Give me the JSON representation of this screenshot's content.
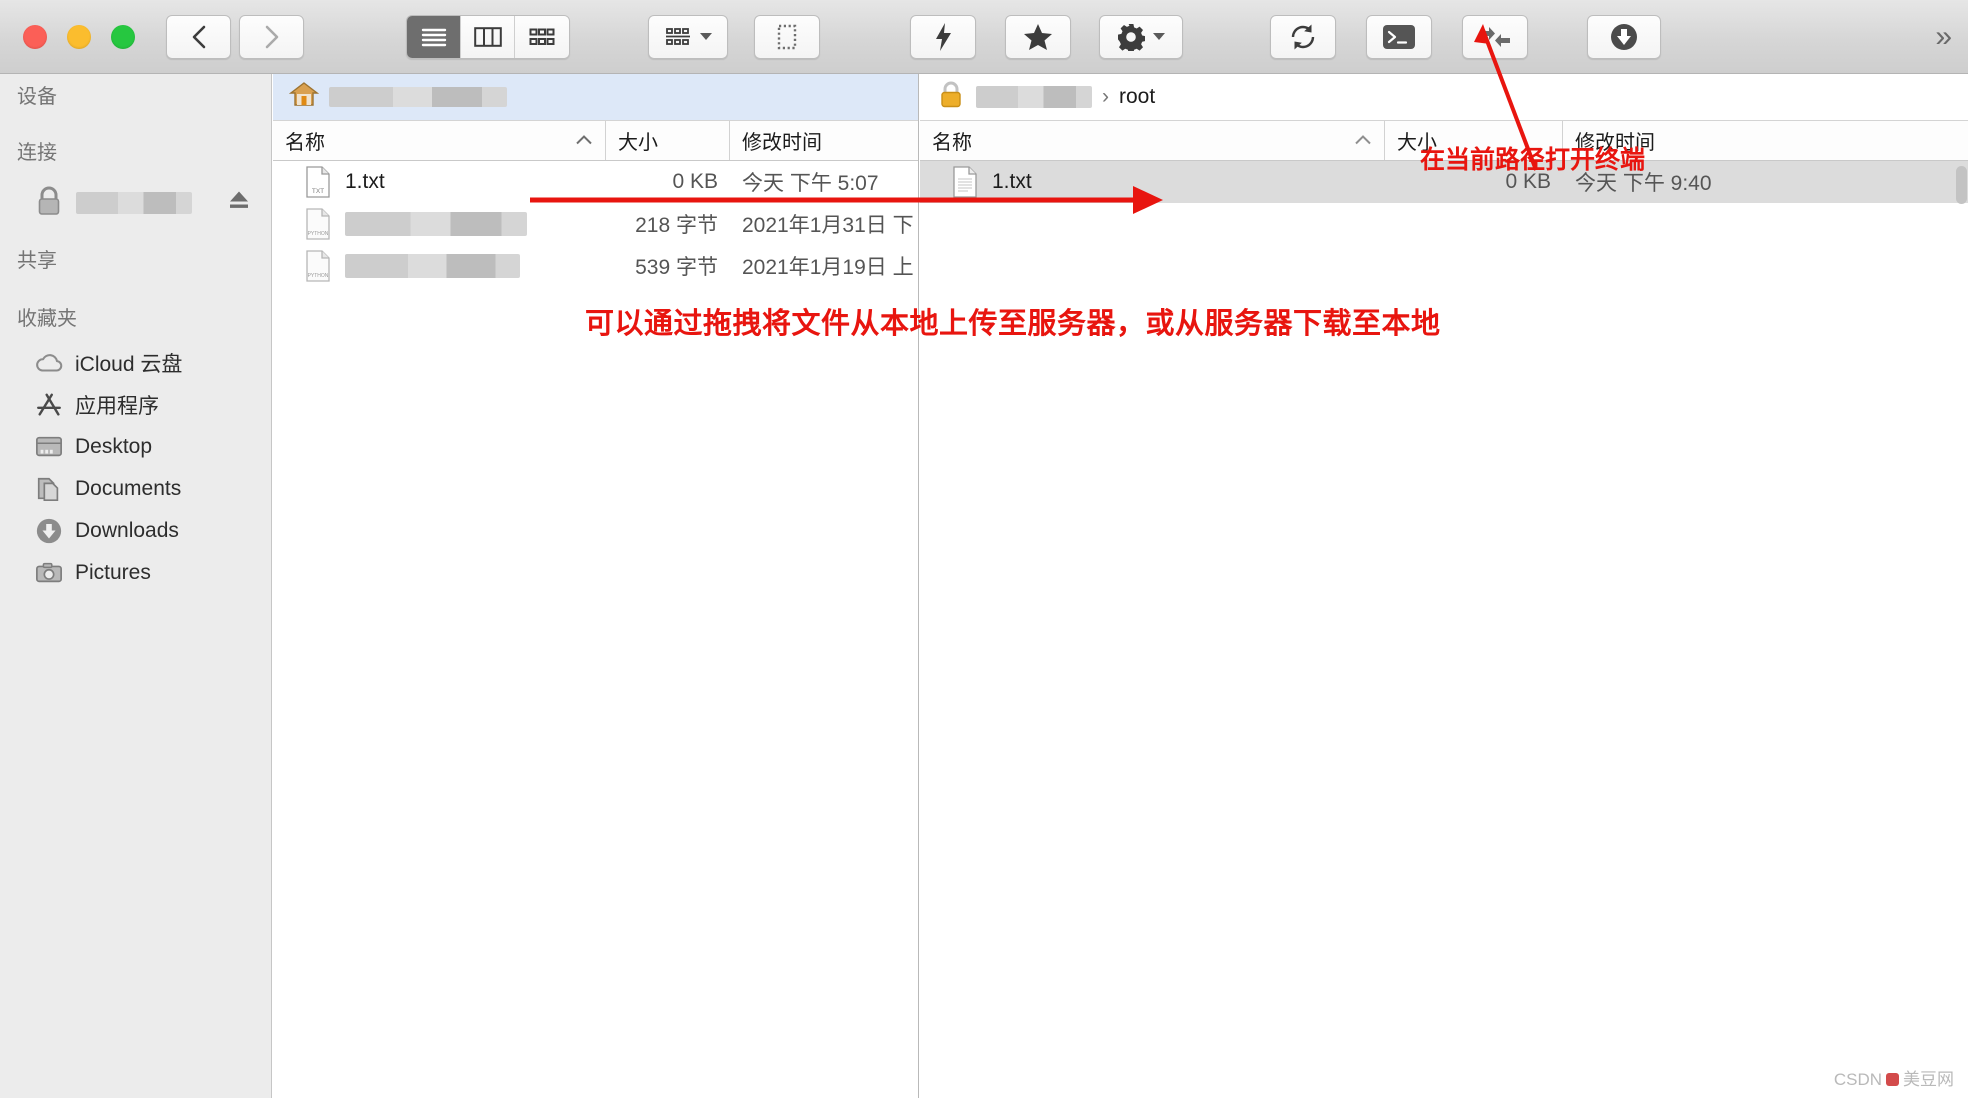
{
  "window": {
    "traffic_lights": [
      "close",
      "minimize",
      "zoom"
    ],
    "colors": {
      "close": "#fb5f57",
      "minimize": "#fbbd2e",
      "zoom": "#26c740",
      "annotation": "#e8150f",
      "selection": "#dde8f8",
      "row_selected": "#dcdcdc"
    }
  },
  "toolbar": {
    "back_label": "‹",
    "forward_label": "›",
    "view_modes": [
      {
        "name": "list-view",
        "active": true
      },
      {
        "name": "column-view",
        "active": false
      },
      {
        "name": "icon-view",
        "active": false
      }
    ],
    "buttons": [
      {
        "name": "arrange-by-button",
        "icon": "grid-icon",
        "has_chevron": true
      },
      {
        "name": "selection-button",
        "icon": "dashed-rect-icon",
        "has_chevron": false
      },
      {
        "name": "quick-action-button",
        "icon": "bolt-icon",
        "has_chevron": false
      },
      {
        "name": "favorites-button",
        "icon": "star-icon",
        "has_chevron": false
      },
      {
        "name": "settings-button",
        "icon": "gear-icon",
        "has_chevron": true
      },
      {
        "name": "refresh-button",
        "icon": "refresh-icon",
        "has_chevron": false
      },
      {
        "name": "terminal-button",
        "icon": "terminal-icon",
        "has_chevron": false
      },
      {
        "name": "sync-button",
        "icon": "sync-arrows-icon",
        "has_chevron": false
      },
      {
        "name": "download-button",
        "icon": "download-circle-icon",
        "has_chevron": false
      }
    ],
    "overflow_label": "»"
  },
  "sidebar": {
    "sections": [
      {
        "title": "设备",
        "items": []
      },
      {
        "title": "连接",
        "items": [
          {
            "label": "",
            "redacted": true,
            "icon": "lock-icon",
            "eject": true
          }
        ]
      },
      {
        "title": "共享",
        "items": []
      },
      {
        "title": "收藏夹",
        "items": [
          {
            "label": "iCloud 云盘",
            "icon": "cloud-icon"
          },
          {
            "label": "应用程序",
            "icon": "app-store-icon"
          },
          {
            "label": "Desktop",
            "icon": "desktop-icon"
          },
          {
            "label": "Documents",
            "icon": "documents-icon"
          },
          {
            "label": "Downloads",
            "icon": "download-circle-icon"
          },
          {
            "label": "Pictures",
            "icon": "camera-icon"
          }
        ]
      }
    ]
  },
  "left_pane": {
    "path_bar": {
      "icon": "home-icon",
      "label": "",
      "redacted": true,
      "selected": true
    },
    "columns": [
      {
        "key": "name",
        "label": "名称",
        "sorted": true,
        "sort_dir": "asc"
      },
      {
        "key": "size",
        "label": "大小"
      },
      {
        "key": "date",
        "label": "修改时间"
      }
    ],
    "rows": [
      {
        "name": "1.txt",
        "redacted": false,
        "size": "0 KB",
        "date": "今天 下午 5:07",
        "icon": "txt-file-icon"
      },
      {
        "name": "",
        "redacted": true,
        "size": "218 字节",
        "date": "2021年1月31日 下",
        "icon": "python-file-icon"
      },
      {
        "name": "",
        "redacted": true,
        "size": "539 字节",
        "date": "2021年1月19日 上",
        "icon": "python-file-icon"
      }
    ]
  },
  "right_pane": {
    "path_bar": {
      "icon": "lock-icon",
      "host": "",
      "redacted": true,
      "separator": "›",
      "current": "root"
    },
    "columns": [
      {
        "key": "name",
        "label": "名称",
        "sorted": true,
        "sort_dir": "asc"
      },
      {
        "key": "size",
        "label": "大小"
      },
      {
        "key": "date",
        "label": "修改时间"
      }
    ],
    "rows": [
      {
        "name": "1.txt",
        "redacted": false,
        "size": "0 KB",
        "date": "今天 下午 9:40",
        "icon": "text-file-icon",
        "selected": true
      }
    ]
  },
  "annotations": {
    "terminal_note": "在当前路径打开终端",
    "drag_note": "可以通过拖拽将文件从本地上传至服务器，或从服务器下载至本地"
  },
  "watermark": {
    "prefix": "CSDN",
    "suffix": "美豆网"
  }
}
